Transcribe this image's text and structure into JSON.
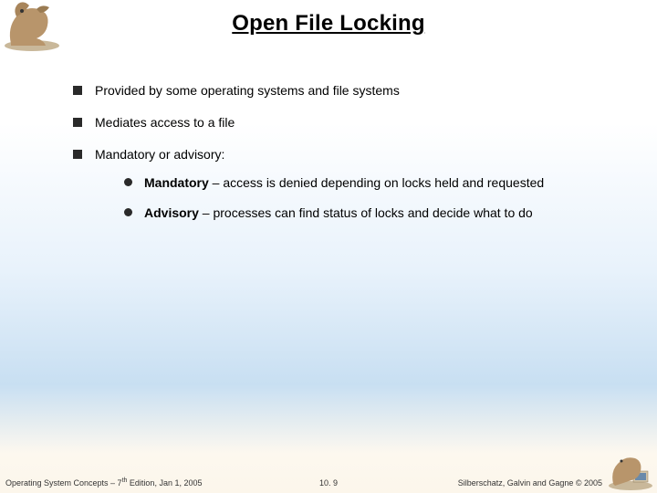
{
  "title": "Open File Locking",
  "bullets": [
    {
      "text": "Provided by some operating systems and file systems"
    },
    {
      "text": "Mediates access to a file"
    },
    {
      "text": "Mandatory or advisory:",
      "sub": [
        {
          "bold": "Mandatory",
          "rest": " – access is denied depending on locks held and requested"
        },
        {
          "bold": "Advisory",
          "rest": " – processes can find status of locks and decide what to do"
        }
      ]
    }
  ],
  "footer": {
    "left_a": "Operating System Concepts – 7",
    "left_sup": "th",
    "left_b": " Edition, Jan 1, 2005",
    "center": "10. 9",
    "right": "Silberschatz, Galvin and Gagne © 2005"
  }
}
